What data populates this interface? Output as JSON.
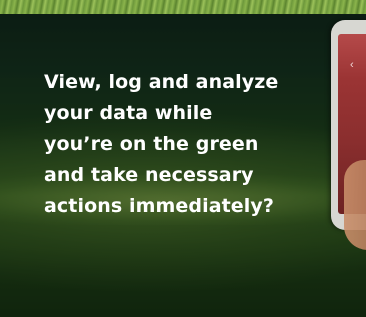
{
  "promo": {
    "headline_lines": [
      "View, log and analyze",
      "your data while",
      "you’re on the green",
      "and take necessary",
      "actions immediately?"
    ]
  },
  "phone": {
    "back_icon": "chevron-left-icon"
  },
  "colors": {
    "text": "#ffffff",
    "background": "#1f3a14",
    "phone_screen": "#9b3434"
  }
}
